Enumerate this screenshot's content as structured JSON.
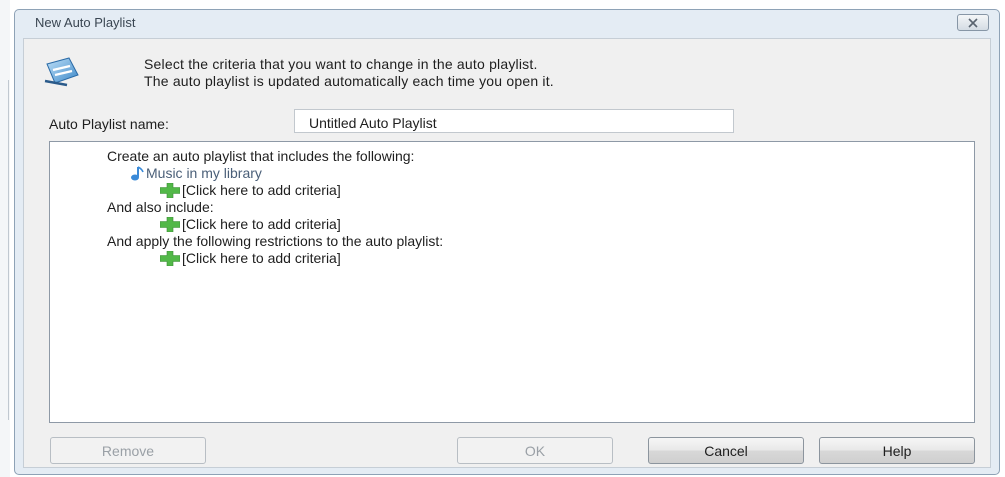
{
  "window": {
    "title": "New Auto Playlist"
  },
  "header": {
    "instruction_line1": "Select the criteria that you want to change in the auto playlist.",
    "instruction_line2": "The auto playlist is updated automatically each time you open it.",
    "icon": "playlist-edit-icon"
  },
  "name_field": {
    "label": "Auto Playlist name:",
    "value": "Untitled Auto Playlist"
  },
  "criteria": {
    "intro": "Create an auto playlist that includes the following:",
    "source": "Music in my library",
    "add_criteria_1": "[Click here to add criteria]",
    "also_include": "And also include:",
    "add_criteria_2": "[Click here to add criteria]",
    "restrictions": "And apply the following restrictions to the auto playlist:",
    "add_criteria_3": "[Click here to add criteria]"
  },
  "buttons": {
    "remove": "Remove",
    "ok": "OK",
    "cancel": "Cancel",
    "help": "Help"
  },
  "colors": {
    "dialog_frame": "#e4ecf4",
    "plus_icon": "#52b848",
    "music_note": "#3a8ad8",
    "disabled_text": "#9aa0a6"
  }
}
